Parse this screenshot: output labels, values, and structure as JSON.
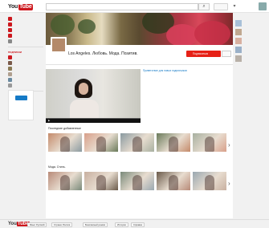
{
  "header": {
    "logo_you": "You",
    "logo_tube": "Tube"
  },
  "guide": {
    "items": [
      {
        "label": "",
        "color": "#cc181e"
      },
      {
        "label": "",
        "color": "#cc181e"
      },
      {
        "label": "",
        "color": "#cc181e"
      },
      {
        "label": "",
        "color": "#cc181e"
      },
      {
        "label": "",
        "color": "#888888"
      }
    ],
    "subs_title": "ПОДПИСКИ",
    "subs": [
      {
        "label": "",
        "color": "#cc181e"
      },
      {
        "label": "",
        "color": "#7a5a4a"
      },
      {
        "label": "",
        "color": "#8a7a55"
      },
      {
        "label": "",
        "color": "#b0a090"
      },
      {
        "label": "",
        "color": "#6a8aa0"
      },
      {
        "label": "",
        "color": "#999999"
      }
    ],
    "browse_label": "",
    "promo_text": "",
    "promo_button": ""
  },
  "channel": {
    "name": "Los Angeles. Любовь. Мода. Позитив.",
    "subscribe_label": "Подписаться",
    "sub_count": "",
    "banner_links": []
  },
  "tabs": [],
  "featured": {
    "title": "Приветствие для новых подписчиков",
    "meta": ""
  },
  "sections": [
    {
      "title": "Последние добавленные"
    },
    {
      "title": "Мода. Стиль."
    }
  ],
  "rail": {
    "heading": "",
    "items": [
      {
        "color": "#a8c0d8"
      },
      {
        "color": "#c0a890"
      },
      {
        "color": "#d8b0a0"
      },
      {
        "color": "#9ab0c8"
      },
      {
        "color": "#b8b0a8"
      }
    ]
  },
  "footer": {
    "logo_you": "You",
    "logo_tube": "Tube",
    "language": "Язык: Русский",
    "country": "Страна: Россия",
    "safety": "Безопасный режим",
    "history": "История",
    "help": "Справка"
  }
}
